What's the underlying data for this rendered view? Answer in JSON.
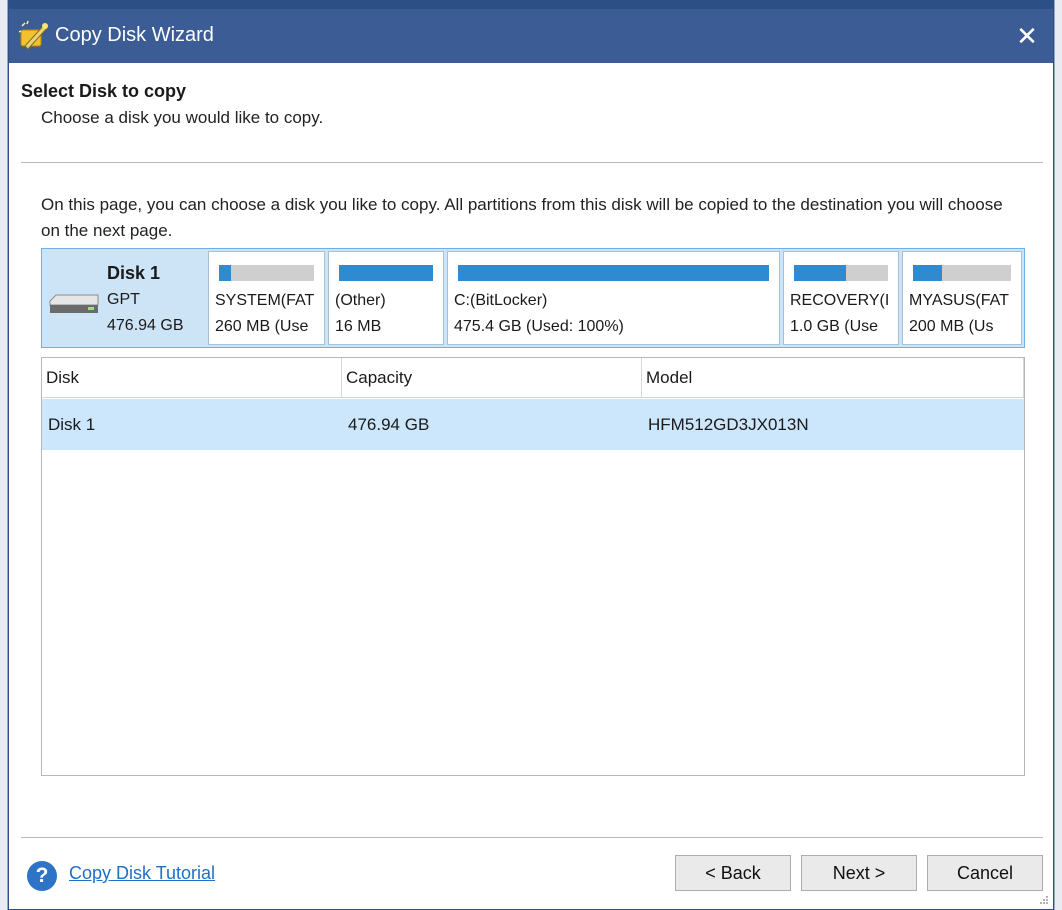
{
  "window": {
    "title": "Copy Disk Wizard",
    "close_label": "✕"
  },
  "header": {
    "heading": "Select Disk to copy",
    "subheading": "Choose a disk you would like to copy."
  },
  "description": "On this page, you can choose a disk you like to copy. All partitions from this disk will be copied to the destination you will choose on the next page.",
  "disk_map": {
    "disk_name": "Disk 1",
    "disk_type": "GPT",
    "disk_size": "476.94 GB",
    "partitions": [
      {
        "name": "SYSTEM(FAT",
        "info": "260 MB (Use",
        "used_fraction": 0.13
      },
      {
        "name": "(Other)",
        "info": "16 MB",
        "used_fraction": 1.0
      },
      {
        "name": "C:(BitLocker)",
        "info": "475.4 GB (Used: 100%)",
        "used_fraction": 1.0
      },
      {
        "name": "RECOVERY(I",
        "info": "1.0 GB (Use",
        "used_fraction": 0.55
      },
      {
        "name": "MYASUS(FAT",
        "info": "200 MB (Us",
        "used_fraction": 0.3
      }
    ]
  },
  "table": {
    "columns": [
      "Disk",
      "Capacity",
      "Model"
    ],
    "rows": [
      {
        "disk": "Disk 1",
        "capacity": "476.94 GB",
        "model": "HFM512GD3JX013N"
      }
    ]
  },
  "footer": {
    "help_icon": "?",
    "tutorial_link": "Copy Disk Tutorial",
    "back_label": "< Back",
    "next_label": "Next >",
    "cancel_label": "Cancel"
  },
  "colors": {
    "titlebar": "#3b5c94",
    "selection": "#cce6fb",
    "usage_bar": "#2f8ad0",
    "link": "#1f6fc6"
  },
  "icons": {
    "app": "copy-disk-wizard-icon",
    "drive": "hard-drive-icon",
    "help": "help-icon",
    "close": "close-icon"
  }
}
